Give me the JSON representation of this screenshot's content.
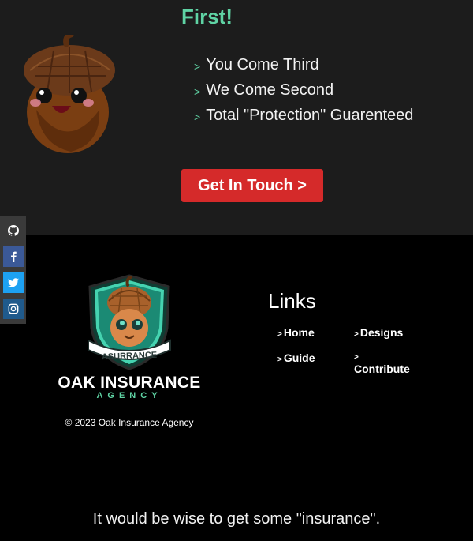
{
  "hero": {
    "title": "First!",
    "bullet_marker": ">",
    "bullets": [
      "You Come Third",
      "We Come Second",
      "Total \"Protection\" Guarenteed"
    ],
    "cta_label": "Get In Touch >"
  },
  "social": {
    "icons": [
      "github-icon",
      "facebook-icon",
      "twitter-icon",
      "instagram-icon"
    ]
  },
  "footer": {
    "logo_ribbon": "ASURRANCE",
    "brand_name": "OAK INSURANCE",
    "brand_sub": "AGENCY",
    "copyright": "© 2023 Oak Insurance Agency",
    "links_title": "Links",
    "link_marker": ">",
    "links": [
      "Home",
      "Designs",
      "Guide",
      "Contribute"
    ]
  },
  "tagline": "It would be wise to get some \"insurance\".",
  "colors": {
    "accent": "#5fd3a4",
    "cta": "#d52a2a",
    "hero_bg": "#1c1c1c",
    "footer_bg": "#000000"
  }
}
